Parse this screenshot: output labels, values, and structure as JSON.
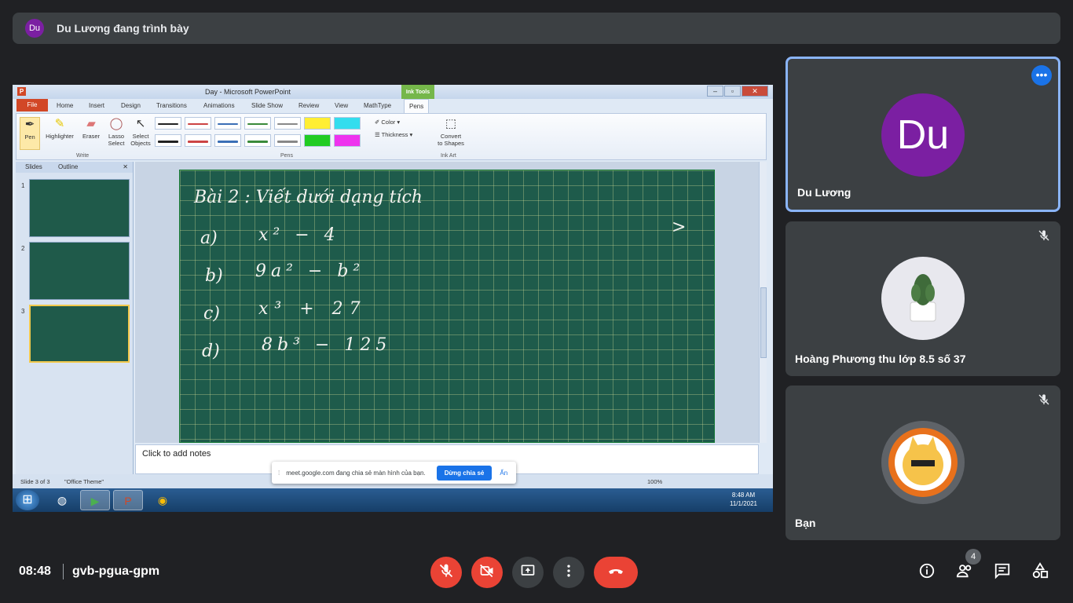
{
  "presenter": {
    "avatar_initials": "Du",
    "text": "Du Lương đang trình bày"
  },
  "ppt": {
    "title": "Day - Microsoft PowerPoint",
    "app_icon": "P",
    "ink_tools_label": "Ink Tools",
    "tabs": [
      "File",
      "Home",
      "Insert",
      "Design",
      "Transitions",
      "Animations",
      "Slide Show",
      "Review",
      "View",
      "MathType",
      "Pens"
    ],
    "tools": {
      "pen": "Pen",
      "highlighter": "Highlighter",
      "eraser": "Eraser",
      "lasso": "Lasso\nSelect",
      "select": "Select\nObjects",
      "color": "Color",
      "thickness": "Thickness",
      "convert": "Convert\nto Shapes"
    },
    "groups": {
      "write": "Write",
      "pens": "Pens",
      "ink_art": "Ink Art"
    },
    "sidebar_tabs": {
      "slides": "Slides",
      "outline": "Outline"
    },
    "slide_numbers": [
      "1",
      "2",
      "3"
    ],
    "notes_placeholder": "Click to add notes",
    "status": {
      "slide": "Slide 3 of 3",
      "theme": "\"Office Theme\"",
      "zoom": "100%"
    },
    "board": {
      "title": "Bài 2 :   Viết   dưới   dạng   tích",
      "items": [
        {
          "label": "a)",
          "expr": "x² − 4"
        },
        {
          "label": "b)",
          "expr": "9a² − b²"
        },
        {
          "label": "c)",
          "expr": "x³ + 27"
        },
        {
          "label": "d)",
          "expr": "8b³ − 125"
        }
      ]
    }
  },
  "share_banner": {
    "text": "meet.google.com đang chia sẻ màn hình của bạn.",
    "stop": "Dừng chia sẻ",
    "hide": "Ẩn"
  },
  "taskbar": {
    "time": "8:48 AM",
    "date": "11/1/2021"
  },
  "participants": [
    {
      "initials": "Du",
      "name": "Du Lương",
      "avatar_color": "#7b1fa2"
    },
    {
      "name": "Hoàng Phương thu lớp 8.5 số 37"
    },
    {
      "name": "Bạn"
    }
  ],
  "meeting": {
    "time": "08:48",
    "code": "gvb-pgua-gpm",
    "participant_count": "4"
  },
  "colors": {
    "background": "#202124",
    "tile": "#3c4043",
    "red": "#ea4335",
    "accent": "#8ab4f8",
    "blue": "#1a73e8"
  }
}
